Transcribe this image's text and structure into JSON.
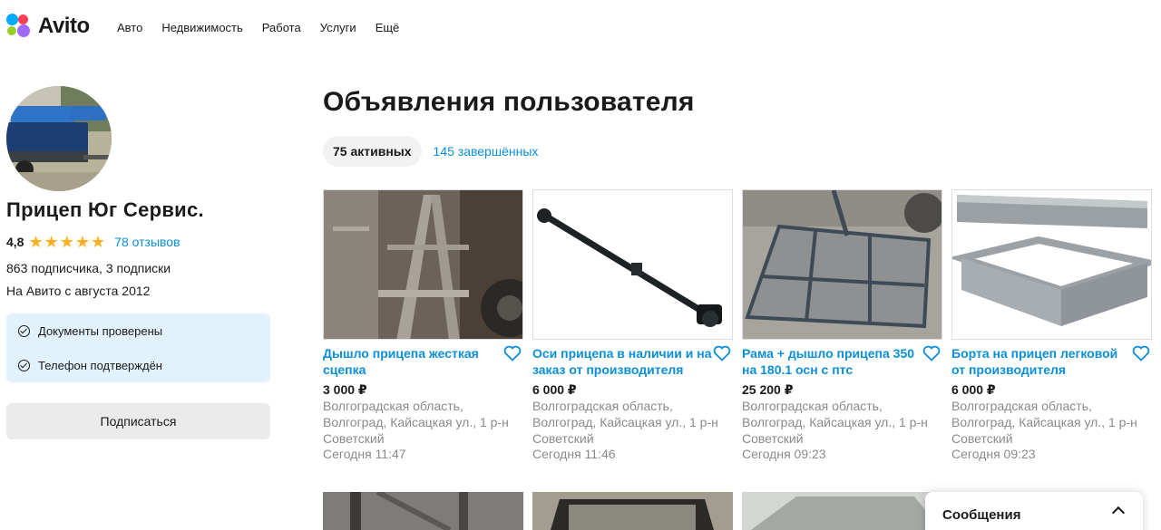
{
  "header": {
    "logo_text": "Avito",
    "nav": [
      "Авто",
      "Недвижимость",
      "Работа",
      "Услуги",
      "Ещё"
    ]
  },
  "profile": {
    "name": "Прицеп Юг Сервис.",
    "rating": "4,8",
    "stars": 5,
    "reviews": "78 отзывов",
    "subscribers": "863 подписчика, 3 подписки",
    "since": "На Авито с августа 2012",
    "verifications": [
      "Документы проверены",
      "Телефон подтверждён"
    ],
    "subscribe_label": "Подписаться"
  },
  "main": {
    "title": "Объявления пользователя",
    "tab_active": "75 активных",
    "tab_completed": "145 завершённых"
  },
  "listings": [
    {
      "title": "Дышло прицепа жесткая сцепка",
      "price": "3 000 ₽",
      "address": "Волгоградская область, Волгоград, Кайсацкая ул., 1 р-н Советский",
      "date": "Сегодня 11:47"
    },
    {
      "title": "Оси прицепа в наличии и на заказ от производителя",
      "price": "6 000 ₽",
      "address": "Волгоградская область, Волгоград, Кайсацкая ул., 1 р-н Советский",
      "date": "Сегодня 11:46"
    },
    {
      "title": "Рама + дышло прицепа 350 на 180.1 осн с птс",
      "price": "25 200 ₽",
      "address": "Волгоградская область, Волгоград, Кайсацкая ул., 1 р-н Советский",
      "date": "Сегодня 09:23"
    },
    {
      "title": "Борта на прицеп легковой от производителя",
      "price": "6 000 ₽",
      "address": "Волгоградская область, Волгоград, Кайсацкая ул., 1 р-н Советский",
      "date": "Сегодня 09:23"
    }
  ],
  "messages": {
    "label": "Сообщения"
  },
  "colors": {
    "link": "#0a8fd8",
    "star": "#ffb021",
    "verify_bg": "#e2f2fc"
  }
}
